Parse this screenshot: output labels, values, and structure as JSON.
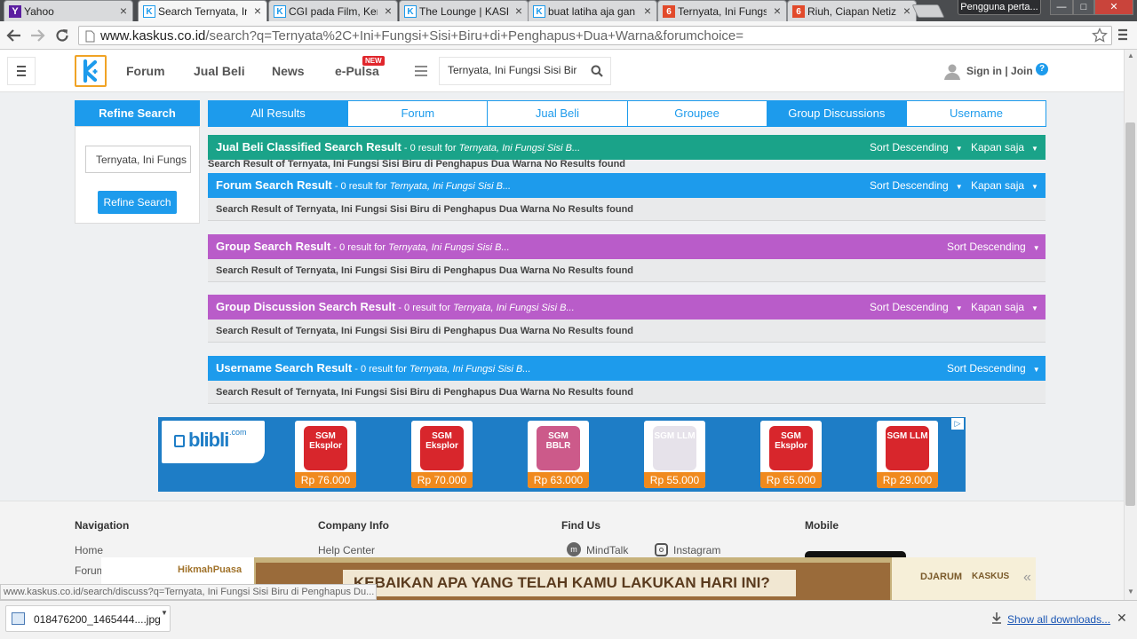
{
  "browser": {
    "tabs": [
      {
        "label": "Yahoo",
        "icon": "yahoo-icon",
        "active": false
      },
      {
        "label": "Search Ternyata, Ini",
        "icon": "kaskus-icon",
        "active": true
      },
      {
        "label": "CGI pada Film, Ken",
        "icon": "kaskus-icon",
        "active": false
      },
      {
        "label": "The Lounge | KASK",
        "icon": "kaskus-icon",
        "active": false
      },
      {
        "label": "buat latiha aja gan",
        "icon": "kaskus-icon",
        "active": false
      },
      {
        "label": "Ternyata, Ini Fungs",
        "icon": "news-icon",
        "active": false
      },
      {
        "label": "Riuh, Ciapan Netiz",
        "icon": "news-icon",
        "active": false
      }
    ],
    "user_badge": "Pengguna perta...",
    "url_host": "www.kaskus.co.id",
    "url_rest": "/search?q=Ternyata%2C+Ini+Fungsi+Sisi+Biru+di+Penghapus+Dua+Warna&forumchoice=",
    "status_url": "www.kaskus.co.id/search/discuss?q=Ternyata, Ini Fungsi Sisi Biru di Penghapus Du..."
  },
  "nav": {
    "links": [
      "Forum",
      "Jual Beli",
      "News",
      "e-Pulsa"
    ],
    "new_badge": "NEW",
    "search_value": "Ternyata, Ini Fungsi Sisi Bir",
    "sign_in": "Sign in | Join"
  },
  "sidebar": {
    "title": "Refine Search",
    "input_value": "Ternyata, Ini Fungs",
    "button": "Refine Search"
  },
  "result_tabs": [
    {
      "label": "All Results",
      "active": true
    },
    {
      "label": "Forum",
      "active": false
    },
    {
      "label": "Jual Beli",
      "active": false
    },
    {
      "label": "Groupee",
      "active": false
    },
    {
      "label": "Group Discussions",
      "active": true
    },
    {
      "label": "Username",
      "active": false
    }
  ],
  "sections": [
    {
      "title": "Jual Beli Classified Search Result",
      "meta": " - 0 result for ",
      "query": "Ternyata, Ini Fungsi Sisi B...",
      "sort": "Sort Descending",
      "time": "Kapan saja",
      "color": "#1aa389",
      "no_result": "Search Result of Ternyata, Ini Fungsi Sisi Biru di Penghapus Dua Warna No Results found"
    },
    {
      "title": "Forum Search Result",
      "meta": " - 0 result for ",
      "query": "Ternyata, Ini Fungsi Sisi B...",
      "sort": "Sort Descending",
      "time": "Kapan saja",
      "color": "#1d9bec",
      "no_result": "Search Result of Ternyata, Ini Fungsi Sisi Biru di Penghapus Dua Warna No Results found"
    },
    {
      "title": "Group Search Result",
      "meta": " - 0 result for ",
      "query": "Ternyata, Ini Fungsi Sisi B...",
      "sort": "Sort Descending",
      "color": "#b95cc9",
      "no_result": "Search Result of Ternyata, Ini Fungsi Sisi Biru di Penghapus Dua Warna No Results found"
    },
    {
      "title": "Group Discussion Search Result",
      "meta": " - 0 result for ",
      "query": "Ternyata, Ini Fungsi Sisi B...",
      "sort": "Sort Descending",
      "time": "Kapan saja",
      "color": "#b95cc9",
      "no_result": "Search Result of Ternyata, Ini Fungsi Sisi Biru di Penghapus Dua Warna No Results found"
    },
    {
      "title": "Username Search Result",
      "meta": " - 0 result for ",
      "query": "Ternyata, Ini Fungsi Sisi B...",
      "sort": "Sort Descending",
      "color": "#1d9bec",
      "no_result": "Search Result of Ternyata, Ini Fungsi Sisi Biru di Penghapus Dua Warna No Results found"
    }
  ],
  "ad": {
    "brand": "blibli",
    "brand_suffix": ".com",
    "products": [
      {
        "name": "SGM Eksplor",
        "price": "Rp 76.000"
      },
      {
        "name": "SGM Eksplor",
        "price": "Rp 70.000"
      },
      {
        "name": "SGM BBLR",
        "price": "Rp 63.000"
      },
      {
        "name": "SGM LLM",
        "price": "Rp 55.000"
      },
      {
        "name": "SGM Eksplor",
        "price": "Rp 65.000"
      },
      {
        "name": "SGM LLM",
        "price": "Rp 29.000"
      }
    ]
  },
  "footer": {
    "navigation": "Navigation",
    "company": "Company Info",
    "find_us": "Find Us",
    "mobile": "Mobile",
    "links": {
      "home": "Home",
      "forum": "Forum",
      "help": "Help Center",
      "mindtalk": "MindTalk",
      "instagram": "Instagram"
    }
  },
  "bottom_ad": {
    "tag": "HikmahPuasa",
    "headline": "KEBAIKAN APA YANG TELAH KAMU LAKUKAN HARI INI?",
    "sponsor": "DJARUM",
    "partner": "KASKUS"
  },
  "downloads": {
    "file": "018476200_1465444....jpg",
    "show_all": "Show all downloads..."
  }
}
